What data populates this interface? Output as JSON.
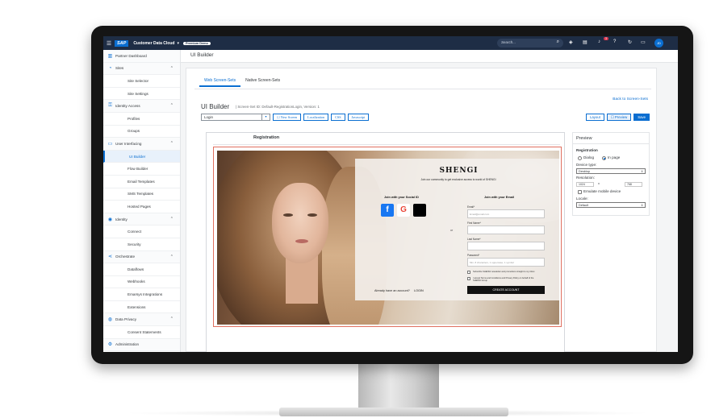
{
  "shell": {
    "menu_icon": "☰",
    "logo": "SAP",
    "product": "Customer Data Cloud",
    "chevron": "▾",
    "badge": "Premium Demo",
    "search_placeholder": "Search...",
    "search_icon": "⌕",
    "notification_count": "3",
    "avatar_initials": "JD"
  },
  "sidebar": {
    "items": [
      {
        "label": "Partner Dashboard",
        "icon": "▥",
        "type": "group"
      },
      {
        "label": "Sites",
        "icon": "◔",
        "type": "group",
        "chevron": "⌃"
      },
      {
        "label": "Site Selector",
        "type": "sub"
      },
      {
        "label": "Site Settings",
        "type": "sub"
      },
      {
        "label": "Identity Access",
        "icon": "⚿",
        "type": "group",
        "chevron": "⌃"
      },
      {
        "label": "Profiles",
        "type": "sub"
      },
      {
        "label": "Groups",
        "type": "sub"
      },
      {
        "label": "User Interfacing",
        "icon": "▭",
        "type": "group",
        "chevron": "⌃"
      },
      {
        "label": "UI Builder",
        "type": "sub",
        "selected": true
      },
      {
        "label": "Flow Builder",
        "type": "sub"
      },
      {
        "label": "Email Templates",
        "type": "sub"
      },
      {
        "label": "SMS Templates",
        "type": "sub"
      },
      {
        "label": "Hosted Pages",
        "type": "sub"
      },
      {
        "label": "Identity",
        "icon": "◉",
        "type": "group",
        "chevron": "⌃"
      },
      {
        "label": "Connect",
        "type": "sub"
      },
      {
        "label": "Security",
        "type": "sub"
      },
      {
        "label": "Orchestrate",
        "icon": "⋖",
        "type": "group",
        "chevron": "⌃"
      },
      {
        "label": "Dataflows",
        "type": "sub"
      },
      {
        "label": "Webhooks",
        "type": "sub"
      },
      {
        "label": "Emarsys Integrations",
        "type": "sub"
      },
      {
        "label": "Extensions",
        "type": "sub"
      },
      {
        "label": "Data Privacy",
        "icon": "◍",
        "type": "group",
        "chevron": "⌃"
      },
      {
        "label": "Consent Statements",
        "type": "sub"
      },
      {
        "label": "Administration",
        "icon": "⚙",
        "type": "group"
      }
    ]
  },
  "page": {
    "title": "UI Builder",
    "tabs": [
      "Web Screen-Sets",
      "Native Screen-Sets"
    ],
    "back_link": "Back to Screen-Sets",
    "builder_title": "UI Builder",
    "builder_sub": "|  Screen-Set ID: Default-RegistrationLogin,  Version: 1",
    "screen_select": "Login",
    "toolbar": [
      "☐ New Screen",
      "Localization",
      "CSS",
      "Javascript"
    ],
    "right_buttons": {
      "layout": "Layout",
      "preview": "☐ Preview",
      "save": "Save"
    }
  },
  "canvas": {
    "title": "Registration",
    "brand": "SHENGI",
    "tagline": "Join our community to get exclusive access to world of SHENGI",
    "social_head": "Join with your Social ID",
    "email_head": "Join with your Email",
    "or": "or",
    "social_buttons": [
      {
        "glyph": "f",
        "name": "facebook-icon",
        "bg": "#1877f2",
        "fg": "#ffffff"
      },
      {
        "glyph": "G",
        "name": "google-icon",
        "bg": "#ffffff",
        "fg": "#ea4335"
      },
      {
        "glyph": "",
        "name": "apple-icon",
        "bg": "#000000",
        "fg": "#ffffff"
      }
    ],
    "fields": [
      {
        "label": "Email*",
        "placeholder": "Email@email.com"
      },
      {
        "label": "First Name*",
        "placeholder": ""
      },
      {
        "label": "Last Name*",
        "placeholder": ""
      },
      {
        "label": "Password*",
        "placeholder": "Min. 8 characters, 1 uppercase, 1 symbol"
      }
    ],
    "checkboxes": [
      "Subscribe SHENGI newsletter and promotions straight to my inbox",
      "I accept Terms and Conditions and Privacy Policy on behalf of the SHENGI Group"
    ],
    "create_button": "CREATE ACCOUNT",
    "already": "Already have an account?",
    "login": "LOGIN"
  },
  "preview": {
    "title": "Preview",
    "section": "Registration",
    "dialog": "Dialog",
    "inpage": "In page",
    "device_label": "Device type:",
    "device_value": "Desktop",
    "resolution_label": "Resolution:",
    "res_w": "1024",
    "res_x": "x",
    "res_h": "768",
    "emulate": "Emulate mobile device",
    "locale_label": "Locale:",
    "locale_value": "Default"
  }
}
